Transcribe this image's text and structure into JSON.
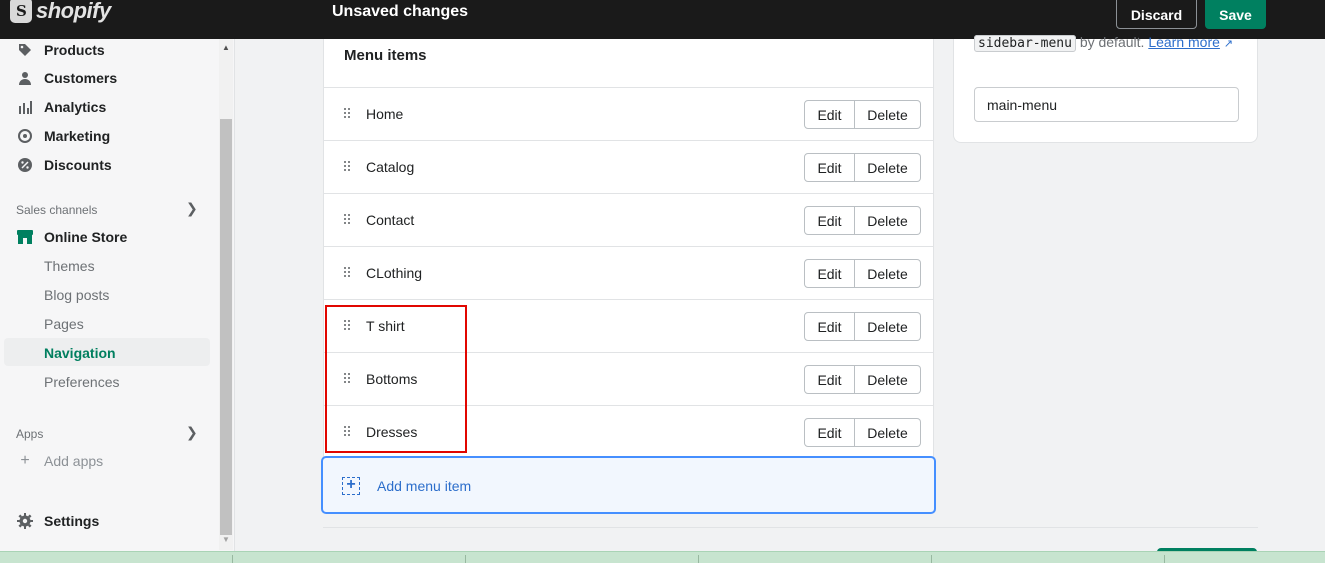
{
  "topbar": {
    "logo_text": "shopify",
    "status": "Unsaved changes",
    "discard_label": "Discard",
    "save_label": "Save"
  },
  "sidebar": {
    "items": [
      {
        "label": "Products",
        "icon": "tag-icon"
      },
      {
        "label": "Customers",
        "icon": "person-icon"
      },
      {
        "label": "Analytics",
        "icon": "bar-chart-icon"
      },
      {
        "label": "Marketing",
        "icon": "target-icon"
      },
      {
        "label": "Discounts",
        "icon": "discount-icon"
      }
    ],
    "sales_channels_label": "Sales channels",
    "online_store_label": "Online Store",
    "online_store_sub": [
      "Themes",
      "Blog posts",
      "Pages",
      "Navigation",
      "Preferences"
    ],
    "active_sub": "Navigation",
    "apps_label": "Apps",
    "add_apps_label": "Add apps",
    "settings_label": "Settings"
  },
  "menu_card": {
    "title": "Menu items",
    "items": [
      "Home",
      "Catalog",
      "Contact",
      "CLothing",
      "T shirt",
      "Bottoms",
      "Dresses"
    ],
    "edit_label": "Edit",
    "delete_label": "Delete",
    "add_label": "Add menu item"
  },
  "handle_card": {
    "code_text": "sidebar-menu",
    "by_default": "by default.",
    "learn_more": "Learn more",
    "handle_value": "main-menu"
  },
  "colors": {
    "accent_green": "#008060",
    "link_blue": "#2c6ecb",
    "highlight_red": "#e10600"
  }
}
